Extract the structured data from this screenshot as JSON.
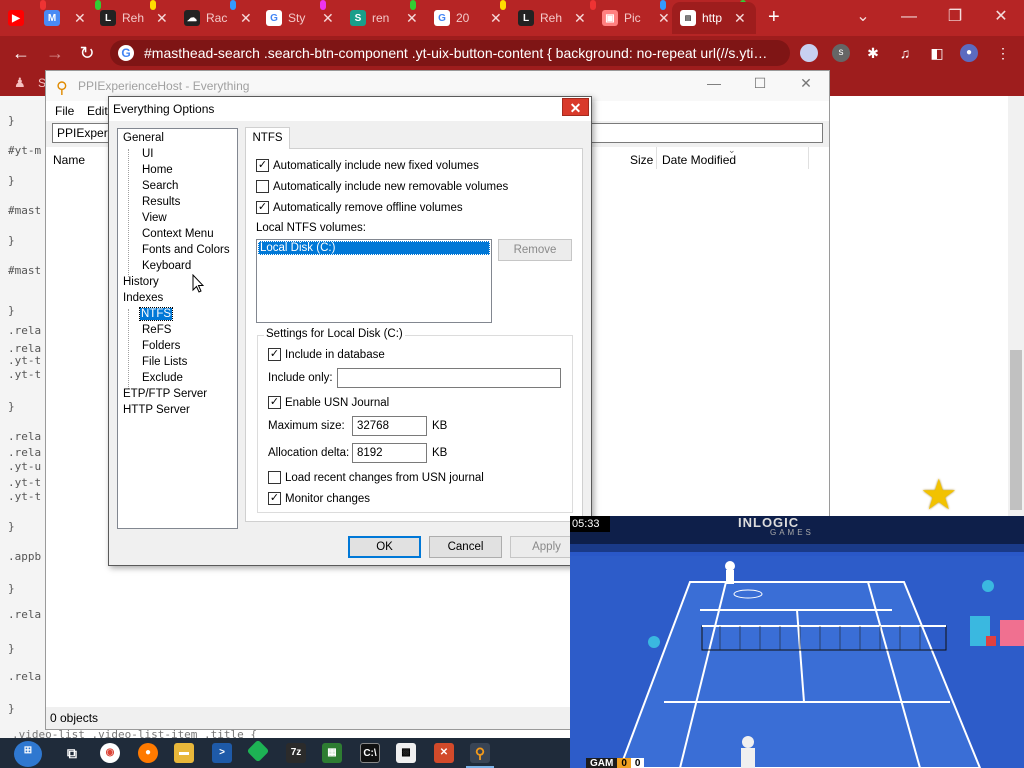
{
  "browser": {
    "tabs": [
      {
        "title": "",
        "favicon": "youtube-icon",
        "color": "#ff0000"
      },
      {
        "title": "",
        "favicon": "gmail-icon",
        "color": "#ea4335"
      },
      {
        "title": "Reh",
        "favicon": "L",
        "color": "#222222"
      },
      {
        "title": "Rac",
        "favicon": "cloud-icon",
        "color": "#222222"
      },
      {
        "title": "Sty",
        "favicon": "google-icon",
        "color": "#ffffff"
      },
      {
        "title": "ren",
        "favicon": "S",
        "color": "#1a9e8a"
      },
      {
        "title": "20",
        "favicon": "G",
        "color": "#ffffff"
      },
      {
        "title": "Reh",
        "favicon": "L",
        "color": "#222222"
      },
      {
        "title": "Pic",
        "favicon": "picture-icon",
        "color": "#ff8080"
      },
      {
        "title": "http",
        "favicon": "page-icon",
        "color": "#ffffff"
      }
    ],
    "address": "#masthead-search .search-btn-component .yt-uix-button-content { background: no-repeat url(//s.yti…",
    "bookmark_letter": "S"
  },
  "page_code_lines": [
    "}",
    "#yt-m",
    "}",
    "#mast",
    "}",
    "#mast",
    "}",
    ".rela",
    ".rela",
    ".yt-t",
    ".yt-t",
    "}",
    ".rela",
    ".rela",
    ".yt-u",
    ".yt-t",
    ".yt-t",
    "}",
    ".appb",
    "}",
    ".rela",
    "}",
    ".rela",
    "}"
  ],
  "bottom_code": ".video-list .video-list-item .title {",
  "everything": {
    "title": "PPIExperienceHost - Everything",
    "menu": [
      "File",
      "Edit"
    ],
    "search_value": "PPIExperie",
    "columns": {
      "name": "Name",
      "size": "Size",
      "modified": "Date Modified"
    },
    "status": "0 objects"
  },
  "dialog": {
    "title": "Everything Options",
    "tree": {
      "general": "General",
      "general_children": [
        "UI",
        "Home",
        "Search",
        "Results",
        "View",
        "Context Menu",
        "Fonts and Colors",
        "Keyboard"
      ],
      "history": "History",
      "indexes": "Indexes",
      "indexes_children": [
        "NTFS",
        "ReFS",
        "Folders",
        "File Lists",
        "Exclude"
      ],
      "etp": "ETP/FTP Server",
      "http": "HTTP Server"
    },
    "tab": "NTFS",
    "checks": {
      "fixed": {
        "label": "Automatically include new fixed volumes",
        "checked": true
      },
      "removable": {
        "label": "Automatically include new removable volumes",
        "checked": false
      },
      "offline": {
        "label": "Automatically remove offline volumes",
        "checked": true
      }
    },
    "local_volumes_label": "Local NTFS volumes:",
    "volumes": [
      "Local Disk (C:)"
    ],
    "remove_button": "Remove",
    "group_label": "Settings for Local Disk (C:)",
    "include_in_db": {
      "label": "Include in database",
      "checked": true
    },
    "include_only_label": "Include only:",
    "include_only_value": "",
    "enable_usn": {
      "label": "Enable USN Journal",
      "checked": true
    },
    "max_size_label": "Maximum size:",
    "max_size_value": "32768",
    "alloc_label": "Allocation delta:",
    "alloc_value": "8192",
    "unit": "KB",
    "load_recent": {
      "label": "Load recent changes from USN journal",
      "checked": false
    },
    "monitor": {
      "label": "Monitor changes",
      "checked": true
    },
    "ok": "OK",
    "cancel": "Cancel",
    "apply": "Apply"
  },
  "game": {
    "time": "05:33",
    "brand": "INLOGIC",
    "brand_sub": "GAMES",
    "player_label": "GAM",
    "score_a": "0",
    "score_b": "0"
  },
  "colors": {
    "chrome_red": "#b62525",
    "select_blue": "#0078d7",
    "court_blue": "#2a58c8"
  }
}
